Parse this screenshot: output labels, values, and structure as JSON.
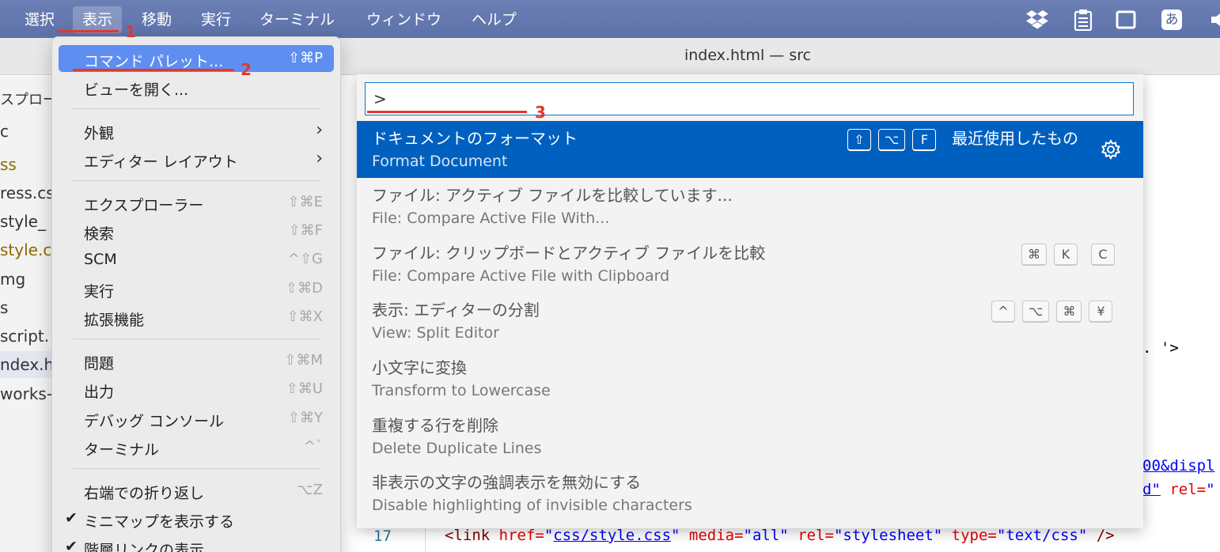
{
  "menubar": {
    "items": [
      {
        "label": "選択"
      },
      {
        "label": "表示"
      },
      {
        "label": "移動"
      },
      {
        "label": "実行"
      },
      {
        "label": "ターミナル"
      },
      {
        "label": "ウィンドウ"
      },
      {
        "label": "ヘルプ"
      }
    ],
    "ime_label": "あ",
    "tray_icons": [
      "dropbox-icon",
      "clipboard-icon",
      "window-icon",
      "ime-icon",
      "volume-icon"
    ]
  },
  "window": {
    "title": "index.html — src"
  },
  "sidebar": {
    "items": [
      "スプロー",
      "c",
      "ss",
      "ress.cs",
      "style_",
      "style.c",
      "mg",
      "s",
      "script.",
      "ndex.ht",
      "works-t"
    ]
  },
  "view_menu": {
    "items": [
      {
        "label": "コマンド パレット...",
        "shortcut": "⇧⌘P",
        "highlighted": true
      },
      {
        "label": "ビューを開く..."
      },
      {
        "label": "外観",
        "submenu": true
      },
      {
        "label": "エディター レイアウト",
        "submenu": true
      },
      {
        "label": "エクスプローラー",
        "shortcut": "⇧⌘E"
      },
      {
        "label": "検索",
        "shortcut": "⇧⌘F"
      },
      {
        "label": "SCM",
        "shortcut": "^⇧G"
      },
      {
        "label": "実行",
        "shortcut": "⇧⌘D"
      },
      {
        "label": "拡張機能",
        "shortcut": "⇧⌘X"
      },
      {
        "label": "問題",
        "shortcut": "⇧⌘M"
      },
      {
        "label": "出力",
        "shortcut": "⇧⌘U"
      },
      {
        "label": "デバッグ コンソール",
        "shortcut": "⇧⌘Y"
      },
      {
        "label": "ターミナル",
        "shortcut": "^`"
      },
      {
        "label": "右端での折り返し",
        "shortcut": "⌥Z"
      },
      {
        "label": "ミニマップを表示する",
        "checked": true
      },
      {
        "label": "階層リンクの表示",
        "checked": true
      }
    ]
  },
  "palette": {
    "input_value": ">",
    "items": [
      {
        "ja": "ドキュメントのフォーマット",
        "en": "Format Document",
        "keys": [
          "⇧",
          "⌥",
          "F"
        ],
        "recent": "最近使用したもの",
        "selected": true
      },
      {
        "ja": "ファイル: アクティブ ファイルを比較しています...",
        "en": "File: Compare Active File With...",
        "keys": []
      },
      {
        "ja": "ファイル: クリップボードとアクティブ ファイルを比較",
        "en": "File: Compare Active File with Clipboard",
        "keys": [
          "⌘",
          "K",
          "C"
        ]
      },
      {
        "ja": "表示: エディターの分割",
        "en": "View: Split Editor",
        "keys": [
          "^",
          "⌥",
          "⌘",
          "¥"
        ]
      },
      {
        "ja": "小文字に変換",
        "en": "Transform to Lowercase",
        "keys": []
      },
      {
        "ja": "重複する行を削除",
        "en": "Delete Duplicate Lines",
        "keys": []
      },
      {
        "ja": "非表示の文字の強調表示を無効にする",
        "en": "Disable highlighting of invisible characters",
        "keys": []
      }
    ]
  },
  "editor": {
    "frag1": ". '>",
    "frag2": "00&displ",
    "frag3_str": "d\"",
    "frag3_attr": " rel=",
    "frag3_end": "\"",
    "line17": {
      "number": "17",
      "open": "<link",
      "a1": " href=",
      "v1q1": "\"",
      "v1": "css/style.css",
      "v1q2": "\"",
      "a2": " media=",
      "v2": "\"all\"",
      "a3": " rel=",
      "v3": "\"stylesheet\"",
      "a4": " type=",
      "v4": "\"text/css\"",
      "close": " />"
    }
  },
  "annotations": [
    "1",
    "2",
    "3"
  ],
  "colors": {
    "menubar": "#5d72aa",
    "selection": "#0060c0",
    "menu_highlight": "#5e8ef0",
    "annotation": "#e0392b"
  }
}
